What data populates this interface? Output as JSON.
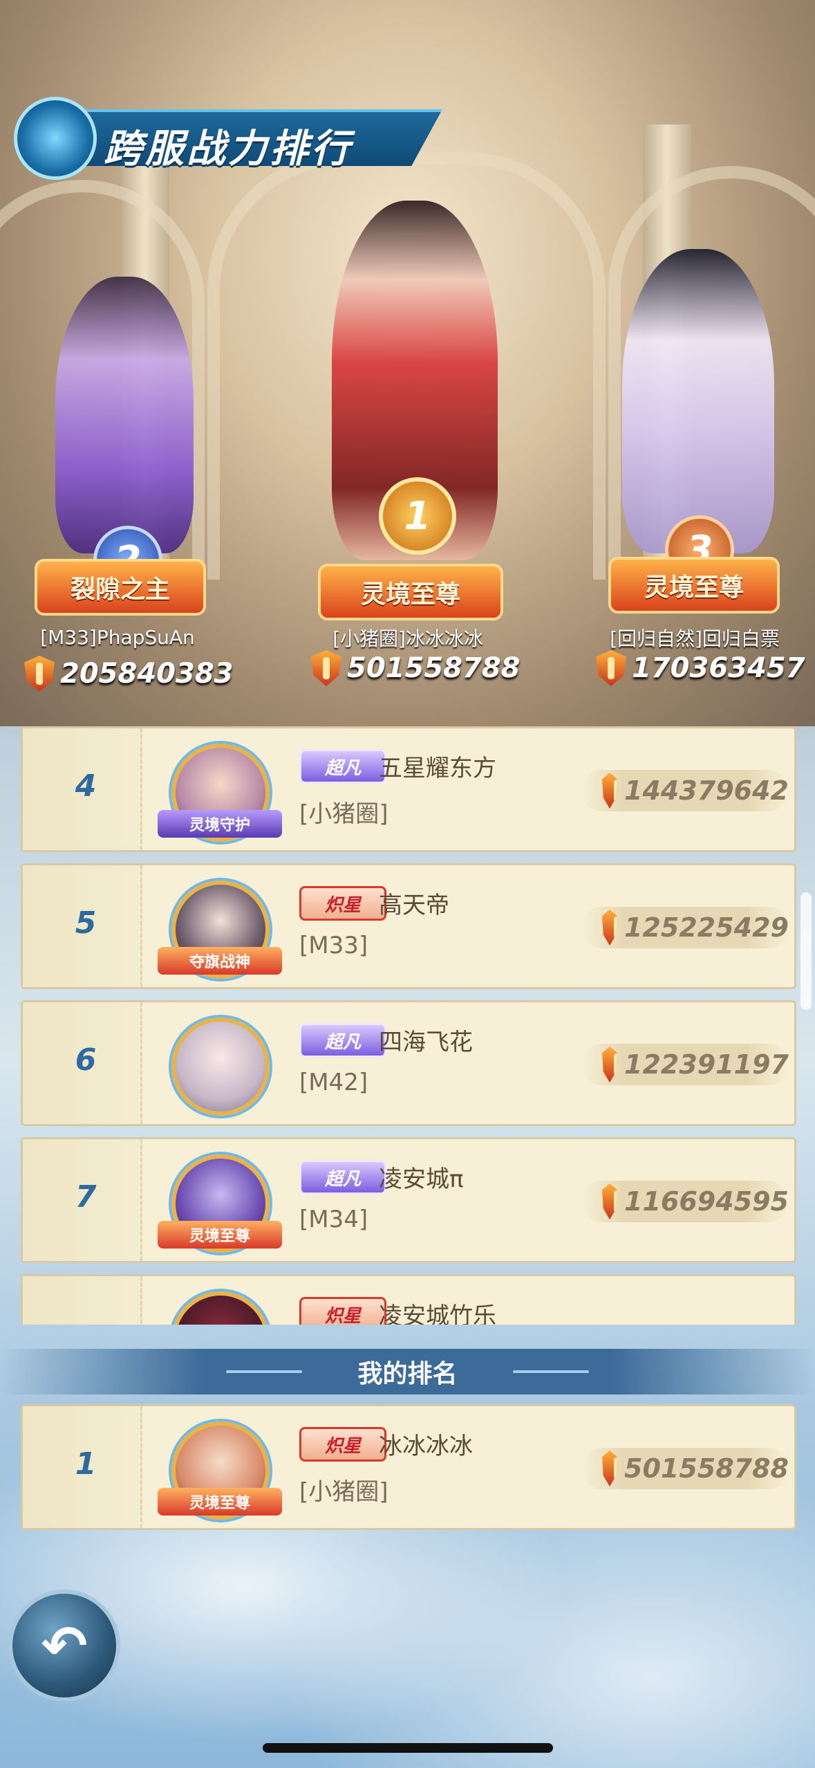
{
  "title": "跨服战力排行",
  "top3": [
    {
      "rank": "2",
      "title": "裂隙之主",
      "name": "[M33]PhapSuAn",
      "power": "205840383"
    },
    {
      "rank": "1",
      "title": "灵境至尊",
      "name": "[小猪圈]冰冰冰冰",
      "power": "501558788"
    },
    {
      "rank": "3",
      "title": "灵境至尊",
      "name": "[回归自然]回归白票",
      "power": "170363457"
    }
  ],
  "rows": [
    {
      "rank": "4",
      "badge": "超凡",
      "badge_style": "chaofan",
      "name": "五星耀东方",
      "guild": "[小猪圈]",
      "power": "144379642",
      "avatar_tag": "灵境守护",
      "tag_color": "#7a5ad0"
    },
    {
      "rank": "5",
      "badge": "炽星",
      "badge_style": "chixing",
      "name": "高天帝",
      "guild": "[M33]",
      "power": "125225429",
      "avatar_tag": "夺旗战神",
      "tag_color": "#e2582a"
    },
    {
      "rank": "6",
      "badge": "超凡",
      "badge_style": "chaofan",
      "name": "四海飞花",
      "guild": "[M42]",
      "power": "122391197",
      "avatar_tag": "",
      "tag_color": ""
    },
    {
      "rank": "7",
      "badge": "超凡",
      "badge_style": "chaofan",
      "name": "凌安城π",
      "guild": "[M34]",
      "power": "116694595",
      "avatar_tag": "灵境至尊",
      "tag_color": "#e2582a"
    },
    {
      "rank": "",
      "badge": "炽星",
      "badge_style": "chixing",
      "name": "凌安城竹乐",
      "guild": "",
      "power": "",
      "avatar_tag": "",
      "tag_color": ""
    }
  ],
  "my_rank_label": "我的排名",
  "my_rank": {
    "rank": "1",
    "badge": "炽星",
    "name": "冰冰冰冰",
    "guild": "[小猪圈]",
    "power": "501558788",
    "avatar_tag": "灵境至尊"
  },
  "colors": {
    "accent": "#2c6aa0",
    "gold": "#e8b44a"
  },
  "icons": {
    "back": "back-arrow-icon",
    "power": "shield-icon"
  }
}
